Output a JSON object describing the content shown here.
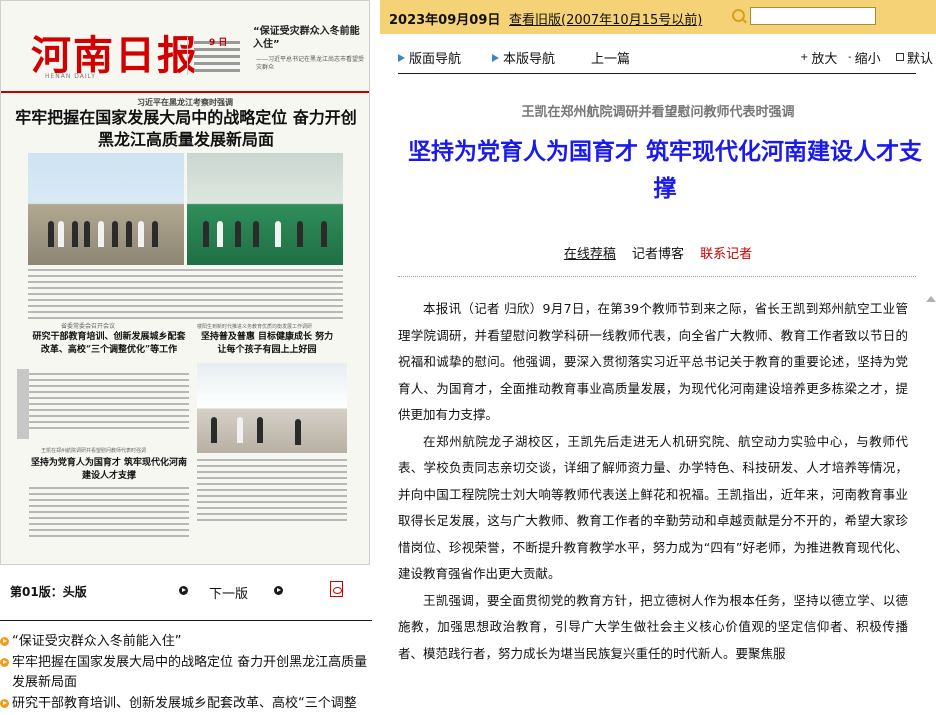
{
  "header": {
    "date": "2023年09月09日",
    "old_edition_link": "查看旧版(2007年10月15号以前)",
    "search_placeholder": ""
  },
  "toolbar": {
    "layout_nav": "版面导航",
    "this_page_nav": "本版导航",
    "prev_article": "上一篇",
    "zoom_in": "放大",
    "zoom_out": "缩小",
    "default": "默认"
  },
  "newspaper": {
    "masthead": "河南日报",
    "masthead_sub": "HENAN DAILY",
    "day": "9 日",
    "teaser_title": "“保证受灾群众入冬前能入住”",
    "teaser_sub": "——习近平总书记在黑龙江尚志市看望受灾群众",
    "lead_kicker": "习近平在黑龙江考察时强调",
    "lead_headline": "牢牢把握在国家发展大局中的战略定位 奋力开创黑龙江高质量发展新局面",
    "story2_kicker": "省委常委会召开会议",
    "story2_headline": "研究干部教育培训、创新发展城乡配套改革、高校“三个调整优化”等工作",
    "story3_kicker": "楼阳生到新时代推进义务教育优质均衡发展工作调研",
    "story3_headline": "坚持普及普惠 目标健康成长 努力让每个孩子有园上上好园",
    "story4_kicker": "王凯在郑州航院调研并看望慰问教师代表时强调",
    "story4_headline": "坚持为党育人为国育才 筑牢现代化河南建设人才支撑"
  },
  "page_nav": {
    "page_label": "第01版：",
    "page_name": "头版",
    "next_page": "下一版"
  },
  "toc": [
    "“保证受灾群众入冬前能入住”",
    "牢牢把握在国家发展大局中的战略定位 奋力开创黑龙江高质量发展新局面",
    "研究干部教育培训、创新发展城乡配套改革、高校“三个调整"
  ],
  "article": {
    "kicker": "王凯在郑州航院调研并看望慰问教师代表时强调",
    "title": "坚持为党育人为国育才 筑牢现代化河南建设人才支撑",
    "links": [
      "在线荐稿",
      "记者博客",
      "联系记者"
    ],
    "paragraphs": [
      "本报讯（记者 归欣）9月7日，在第39个教师节到来之际，省长王凯到郑州航空工业管理学院调研，并看望慰问教学科研一线教师代表，向全省广大教师、教育工作者致以节日的祝福和诚挚的慰问。他强调，要深入贯彻落实习近平总书记关于教育的重要论述，坚持为党育人、为国育才，全面推动教育事业高质量发展，为现代化河南建设培养更多栋梁之才，提供更加有力支撑。",
      "在郑州航院龙子湖校区，王凯先后走进无人机研究院、航空动力实验中心，与教师代表、学校负责同志亲切交谈，详细了解师资力量、办学特色、科技研发、人才培养等情况，并向中国工程院院士刘大响等教师代表送上鲜花和祝福。王凯指出，近年来，河南教育事业取得长足发展，这与广大教师、教育工作者的辛勤劳动和卓越贡献是分不开的，希望大家珍惜岗位、珍视荣誉，不断提升教育教学水平，努力成为“四有”好老师，为推进教育现代化、建设教育强省作出更大贡献。",
      "王凯强调，要全面贯彻党的教育方针，把立德树人作为根本任务，坚持以德立学、以德施教，加强思想政治教育，引导广大学生做社会主义核心价值观的坚定信仰者、积极传播者、模范践行者，努力成长为堪当民族复兴重任的时代新人。要聚焦服"
    ]
  },
  "colors": {
    "topbar": "#f6d277",
    "title_blue": "#1a1aee",
    "masthead_red": "#d40000",
    "bullet_orange": "#f29b1a"
  }
}
